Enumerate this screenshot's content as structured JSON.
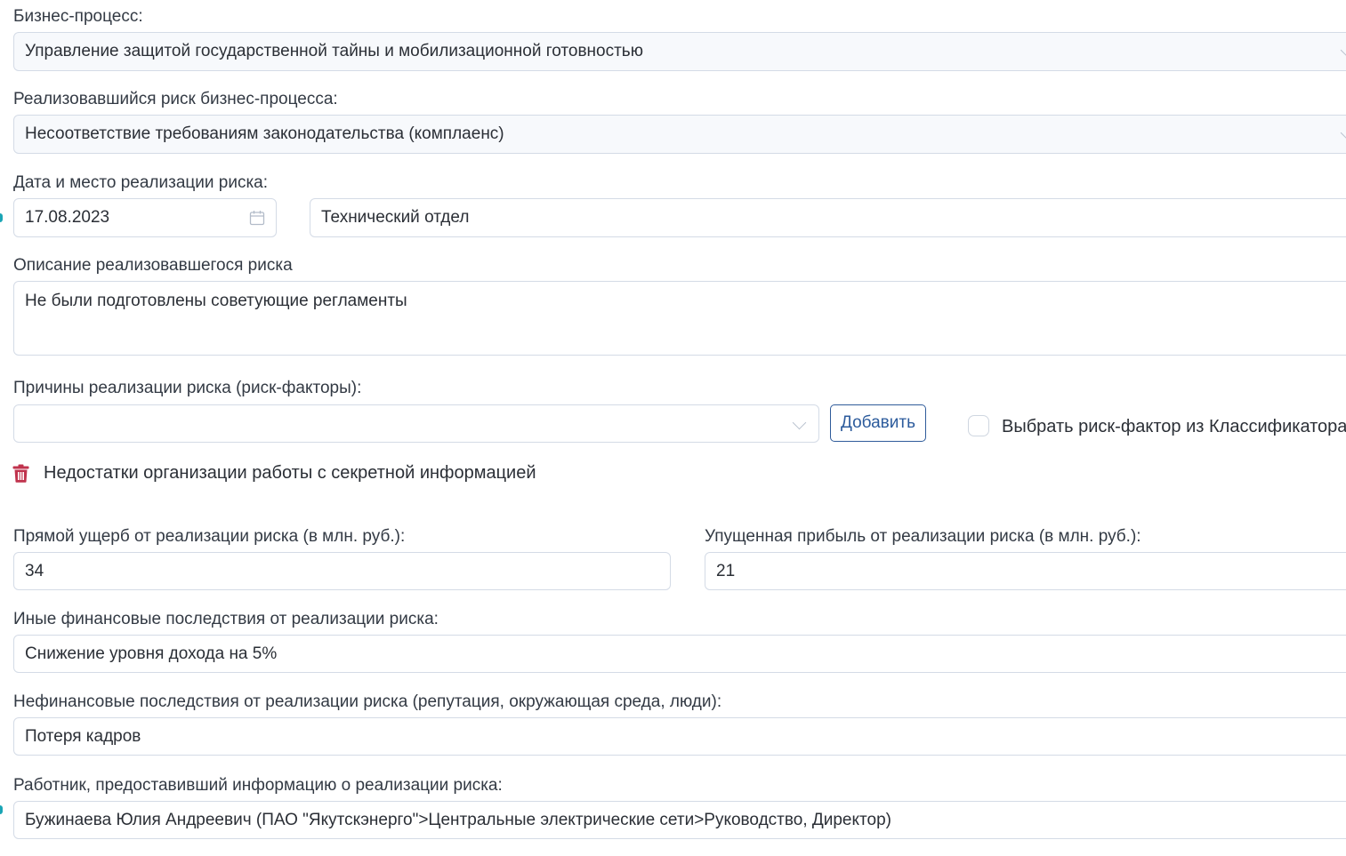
{
  "business_process": {
    "label": "Бизнес-процесс:",
    "value": "Управление защитой государственной тайны и мобилизационной готовностью"
  },
  "realized_risk": {
    "label": "Реализовавшийся риск бизнес-процесса:",
    "value": "Несоответствие требованиям законодательства (комплаенс)"
  },
  "date_place": {
    "label": "Дата и место реализации риска:",
    "date": "17.08.2023",
    "place": "Технический отдел"
  },
  "description": {
    "label": "Описание реализовавшегося риска",
    "value": "Не были подготовлены советующие регламенты"
  },
  "causes": {
    "label": "Причины реализации риска (риск-факторы):",
    "select_value": "",
    "add_button": "Добавить",
    "checkbox_label": "Выбрать риск-фактор из Классификатора",
    "checkbox_checked": false,
    "items": [
      "Недостатки организации работы с секретной информацией"
    ]
  },
  "direct_damage": {
    "label": "Прямой ущерб от реализации риска (в млн. руб.):",
    "value": "34"
  },
  "lost_profit": {
    "label": "Упущенная прибыль от реализации риска (в млн. руб.):",
    "value": "21"
  },
  "other_financial": {
    "label": "Иные финансовые последствия от реализации риска:",
    "value": "Снижение уровня дохода на 5%"
  },
  "non_financial": {
    "label": "Нефинансовые последствия от реализации риска (репутация, окружающая среда, люди):",
    "value": "Потеря кадров"
  },
  "reporter": {
    "label": "Работник, предоставивший информацию о реализации риска:",
    "value": "Бужинаева Юлия Андреевич (ПАО \"Якутскэнерго\">Центральные электрические сети>Руководство, Директор)"
  },
  "colors": {
    "accent": "#1aa5b5",
    "button_border": "#2f5b9a",
    "trash": "#c0334d"
  },
  "icons": {
    "calendar": "calendar-icon",
    "trash": "trash-icon",
    "dropdown": "chevron-down-icon"
  }
}
